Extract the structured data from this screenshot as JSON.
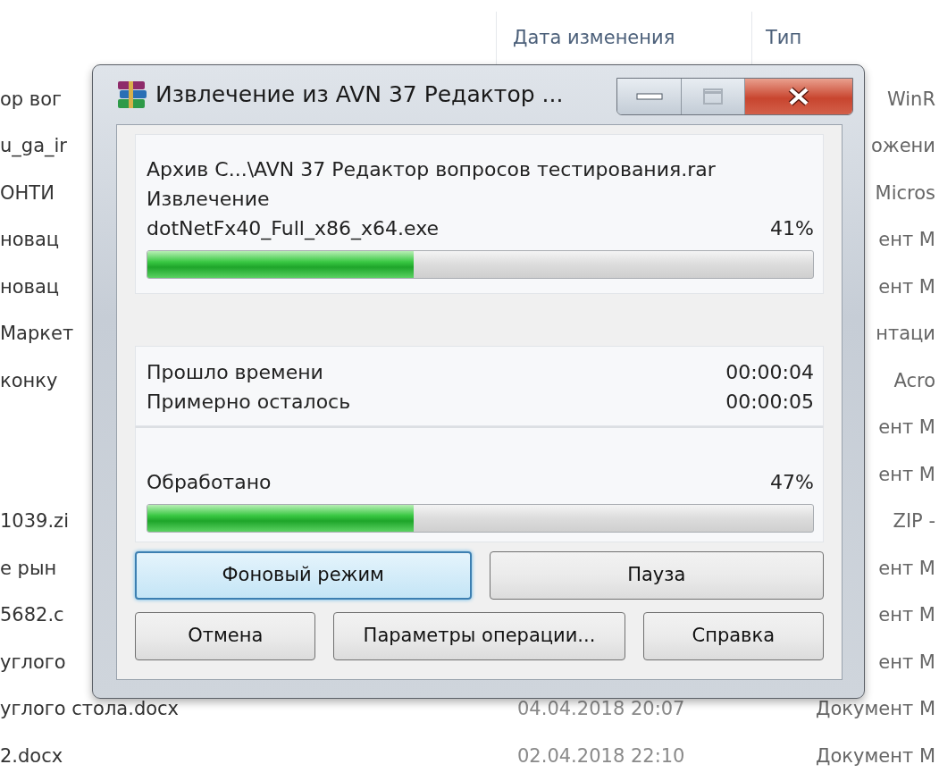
{
  "file_list": {
    "columns": [
      "Дата изменения",
      "Тип"
    ],
    "rows": [
      {
        "name": "ор вог",
        "type": "WinR"
      },
      {
        "name": "u_ga_ir",
        "type": "ожени"
      },
      {
        "name": "ОНТИ",
        "type": "Micros"
      },
      {
        "name": "новац",
        "type": "ент M"
      },
      {
        "name": "новац",
        "type": "ент M"
      },
      {
        "name": "Маркет",
        "type": "нтаци"
      },
      {
        "name": "конку",
        "type": "Acro"
      },
      {
        "type": "ент M"
      },
      {
        "type": "ент M"
      },
      {
        "name": "1039.zi",
        "type": "ZIP -"
      },
      {
        "name": "е рын",
        "type": "ент M"
      },
      {
        "name": "5682.c",
        "type": "ент M"
      },
      {
        "name": "углого",
        "type": "ент M"
      },
      {
        "name": "углого стола.docx",
        "date": "04.04.2018 20:07",
        "type": "Документ M"
      },
      {
        "name": "2.docx",
        "date": "02.04.2018 22:10",
        "type": "Документ M"
      }
    ]
  },
  "dialog": {
    "title": "Извлечение из AVN 37 Редактор ...",
    "archive": "Архив С...\\AVN 37 Редактор вопросов тестирования.rar",
    "action": "Извлечение",
    "file": "dotNetFx40_Full_x86_x64.exe",
    "file_percent": "41%",
    "file_progress": {
      "level": 0.4
    },
    "times": [
      {
        "label": "Прошло времени",
        "value": "00:00:04"
      },
      {
        "label": "Примерно осталось",
        "value": "00:00:05"
      }
    ],
    "processed_label": "Обработано",
    "processed_percent": "47%",
    "processed_progress": {
      "level": 0.4
    },
    "button_rows": [
      [
        {
          "label": "Фоновый режим",
          "focused": true
        },
        {
          "label": "Пауза",
          "focused": false
        }
      ],
      [
        {
          "label": "Отмена",
          "focused": false
        },
        {
          "label": "Параметры операции...",
          "focused": false
        },
        {
          "label": "Справка",
          "focused": false
        }
      ]
    ]
  }
}
